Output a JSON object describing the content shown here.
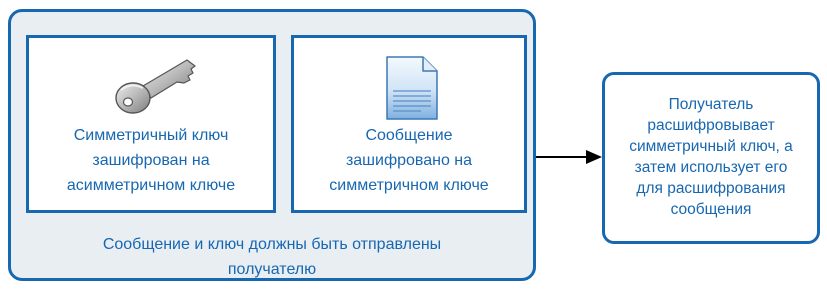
{
  "diagram": {
    "key_box": {
      "icon": "key-icon",
      "lines": [
        "Симметричный ключ",
        "зашифрован на",
        "асимметричном ключе"
      ]
    },
    "message_box": {
      "icon": "document-icon",
      "lines": [
        "Сообщение",
        "зашифровано на",
        "симметричном ключе"
      ]
    },
    "container_caption": {
      "lines": [
        "Сообщение и ключ должны быть отправлены",
        "получателю"
      ]
    },
    "recipient_box": {
      "lines": [
        "Получатель",
        "расшифровывает",
        "симметричный ключ, а",
        "затем использует его",
        "для расшифрования",
        "сообщения"
      ]
    },
    "colors": {
      "accent": "#1767b1",
      "container_fill": "#e9eef3",
      "arrow": "#000000"
    }
  }
}
